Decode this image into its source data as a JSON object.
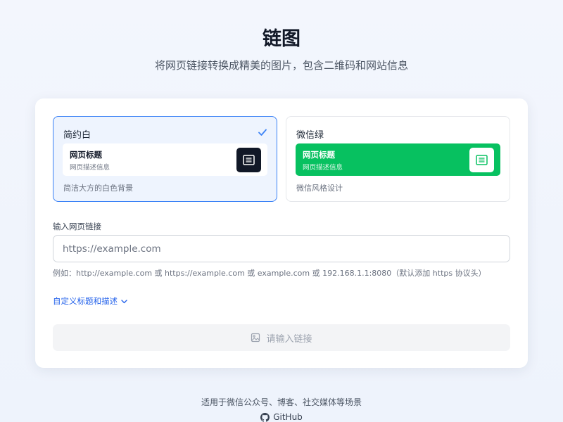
{
  "header": {
    "title": "链图",
    "subtitle": "将网页链接转换成精美的图片，包含二维码和网站信息"
  },
  "themes": [
    {
      "name": "简约白",
      "selected": true,
      "preview_title": "网页标题",
      "preview_desc": "网页描述信息",
      "description": "简洁大方的白色背景",
      "icon": "document-icon"
    },
    {
      "name": "微信绿",
      "selected": false,
      "preview_title": "网页标题",
      "preview_desc": "网页描述信息",
      "description": "微信风格设计",
      "icon": "document-icon"
    }
  ],
  "form": {
    "url_label": "输入网页链接",
    "url_value": "",
    "url_placeholder": "https://example.com",
    "url_hint": "例如：http://example.com 或 https://example.com 或 example.com 或 192.168.1.1:8080（默认添加 https 协议头）",
    "custom_toggle_label": "自定义标题和描述",
    "submit_label": "请输入链接"
  },
  "footer": {
    "text": "适用于微信公众号、博客、社交媒体等场景",
    "github_label": "GitHub"
  },
  "colors": {
    "accent": "#3b82f6",
    "link": "#2563eb",
    "wechat_green": "#07c160",
    "dark": "#111827"
  }
}
